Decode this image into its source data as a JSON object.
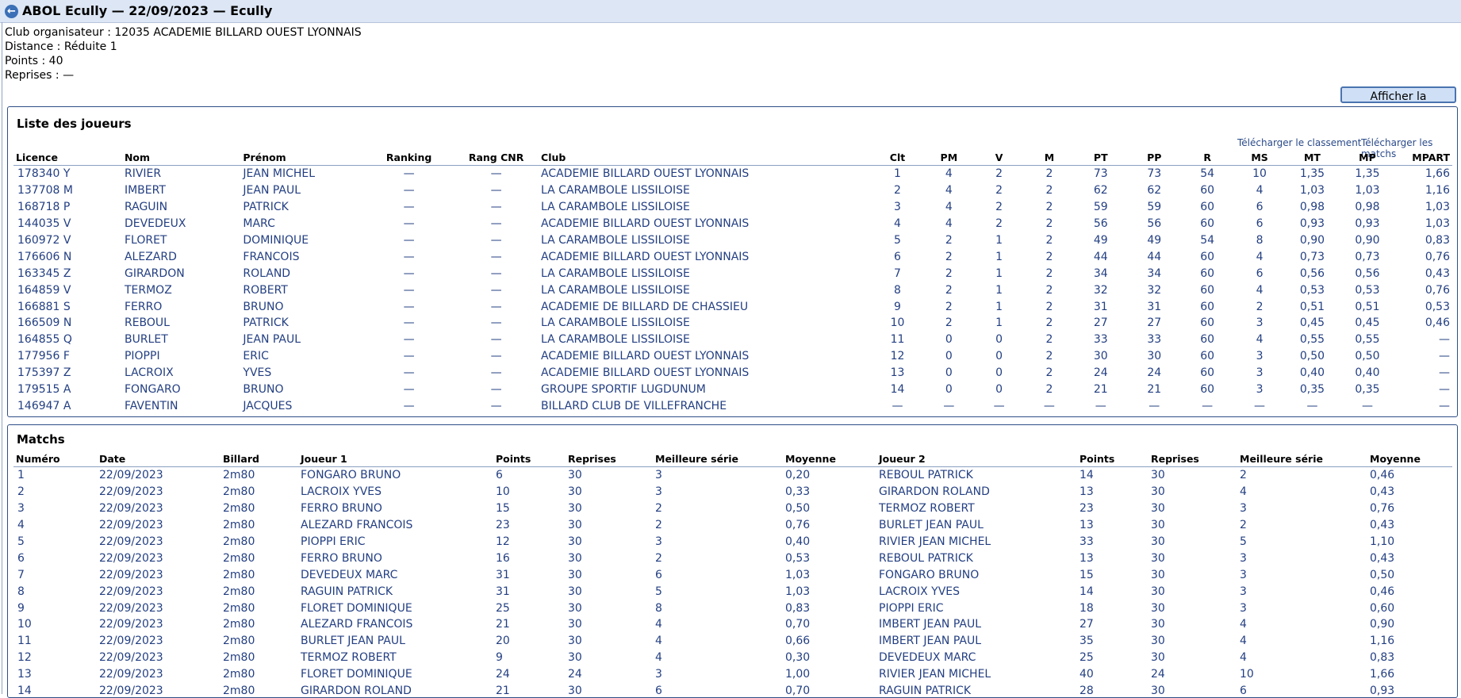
{
  "header": {
    "title": "ABOL Ecully — 22/09/2023 — Ecully",
    "back_icon": "arrow-left-icon"
  },
  "info": {
    "club_line": "Club organisateur : 12035 ACADEMIE BILLARD OUEST LYONNAIS",
    "distance_line": "Distance : Réduite 1",
    "points_line": "Points : 40",
    "reprises_line": "Reprises : —"
  },
  "actions": {
    "synthese_label": "Afficher la synthèse",
    "download_ranking_label": "Télécharger le classement",
    "download_matches_label": "Télécharger les matchs"
  },
  "players": {
    "title": "Liste des joueurs",
    "headers": [
      "Licence",
      "Nom",
      "Prénom",
      "Ranking",
      "Rang CNR",
      "Club",
      "Clt",
      "PM",
      "V",
      "M",
      "PT",
      "PP",
      "R",
      "MS",
      "MT",
      "MP",
      "MPART"
    ],
    "rows": [
      [
        "178340 Y",
        "RIVIER",
        "JEAN MICHEL",
        "—",
        "—",
        "ACADEMIE BILLARD OUEST LYONNAIS",
        "1",
        "4",
        "2",
        "2",
        "73",
        "73",
        "54",
        "10",
        "1,35",
        "1,35",
        "1,66"
      ],
      [
        "137708 M",
        "IMBERT",
        "JEAN PAUL",
        "—",
        "—",
        "LA CARAMBOLE LISSILOISE",
        "2",
        "4",
        "2",
        "2",
        "62",
        "62",
        "60",
        "4",
        "1,03",
        "1,03",
        "1,16"
      ],
      [
        "168718 P",
        "RAGUIN",
        "PATRICK",
        "—",
        "—",
        "LA CARAMBOLE LISSILOISE",
        "3",
        "4",
        "2",
        "2",
        "59",
        "59",
        "60",
        "6",
        "0,98",
        "0,98",
        "1,03"
      ],
      [
        "144035 V",
        "DEVEDEUX",
        "MARC",
        "—",
        "—",
        "ACADEMIE BILLARD OUEST LYONNAIS",
        "4",
        "4",
        "2",
        "2",
        "56",
        "56",
        "60",
        "6",
        "0,93",
        "0,93",
        "1,03"
      ],
      [
        "160972 V",
        "FLORET",
        "DOMINIQUE",
        "—",
        "—",
        "LA CARAMBOLE LISSILOISE",
        "5",
        "2",
        "1",
        "2",
        "49",
        "49",
        "54",
        "8",
        "0,90",
        "0,90",
        "0,83"
      ],
      [
        "176606 N",
        "ALEZARD",
        "FRANCOIS",
        "—",
        "—",
        "ACADEMIE BILLARD OUEST LYONNAIS",
        "6",
        "2",
        "1",
        "2",
        "44",
        "44",
        "60",
        "4",
        "0,73",
        "0,73",
        "0,76"
      ],
      [
        "163345 Z",
        "GIRARDON",
        "ROLAND",
        "—",
        "—",
        "LA CARAMBOLE LISSILOISE",
        "7",
        "2",
        "1",
        "2",
        "34",
        "34",
        "60",
        "6",
        "0,56",
        "0,56",
        "0,43"
      ],
      [
        "164859 V",
        "TERMOZ",
        "ROBERT",
        "—",
        "—",
        "LA CARAMBOLE LISSILOISE",
        "8",
        "2",
        "1",
        "2",
        "32",
        "32",
        "60",
        "4",
        "0,53",
        "0,53",
        "0,76"
      ],
      [
        "166881 S",
        "FERRO",
        "BRUNO",
        "—",
        "—",
        "ACADEMIE DE BILLARD DE CHASSIEU",
        "9",
        "2",
        "1",
        "2",
        "31",
        "31",
        "60",
        "2",
        "0,51",
        "0,51",
        "0,53"
      ],
      [
        "166509 N",
        "REBOUL",
        "PATRICK",
        "—",
        "—",
        "LA CARAMBOLE LISSILOISE",
        "10",
        "2",
        "1",
        "2",
        "27",
        "27",
        "60",
        "3",
        "0,45",
        "0,45",
        "0,46"
      ],
      [
        "164855 Q",
        "BURLET",
        "JEAN PAUL",
        "—",
        "—",
        "LA CARAMBOLE LISSILOISE",
        "11",
        "0",
        "0",
        "2",
        "33",
        "33",
        "60",
        "4",
        "0,55",
        "0,55",
        "—"
      ],
      [
        "177956 F",
        "PIOPPI",
        "ERIC",
        "—",
        "—",
        "ACADEMIE BILLARD OUEST LYONNAIS",
        "12",
        "0",
        "0",
        "2",
        "30",
        "30",
        "60",
        "3",
        "0,50",
        "0,50",
        "—"
      ],
      [
        "175397 Z",
        "LACROIX",
        "YVES",
        "—",
        "—",
        "ACADEMIE BILLARD OUEST LYONNAIS",
        "13",
        "0",
        "0",
        "2",
        "24",
        "24",
        "60",
        "3",
        "0,40",
        "0,40",
        "—"
      ],
      [
        "179515 A",
        "FONGARO",
        "BRUNO",
        "—",
        "—",
        "GROUPE SPORTIF LUGDUNUM",
        "14",
        "0",
        "0",
        "2",
        "21",
        "21",
        "60",
        "3",
        "0,35",
        "0,35",
        "—"
      ],
      [
        "146947 A",
        "FAVENTIN",
        "JACQUES",
        "—",
        "—",
        "BILLARD CLUB DE VILLEFRANCHE",
        "—",
        "—",
        "—",
        "—",
        "—",
        "—",
        "—",
        "—",
        "—",
        "—",
        "—"
      ]
    ]
  },
  "matches": {
    "title": "Matchs",
    "headers": [
      "Numéro",
      "Date",
      "Billard",
      "Joueur 1",
      "Points",
      "Reprises",
      "Meilleure série",
      "Moyenne",
      "Joueur 2",
      "Points",
      "Reprises",
      "Meilleure série",
      "Moyenne"
    ],
    "rows": [
      [
        "1",
        "22/09/2023",
        "2m80",
        "FONGARO BRUNO",
        "6",
        "30",
        "3",
        "0,20",
        "REBOUL PATRICK",
        "14",
        "30",
        "2",
        "0,46"
      ],
      [
        "2",
        "22/09/2023",
        "2m80",
        "LACROIX YVES",
        "10",
        "30",
        "3",
        "0,33",
        "GIRARDON ROLAND",
        "13",
        "30",
        "4",
        "0,43"
      ],
      [
        "3",
        "22/09/2023",
        "2m80",
        "FERRO BRUNO",
        "15",
        "30",
        "2",
        "0,50",
        "TERMOZ ROBERT",
        "23",
        "30",
        "3",
        "0,76"
      ],
      [
        "4",
        "22/09/2023",
        "2m80",
        "ALEZARD FRANCOIS",
        "23",
        "30",
        "2",
        "0,76",
        "BURLET JEAN PAUL",
        "13",
        "30",
        "2",
        "0,43"
      ],
      [
        "5",
        "22/09/2023",
        "2m80",
        "PIOPPI ERIC",
        "12",
        "30",
        "3",
        "0,40",
        "RIVIER JEAN MICHEL",
        "33",
        "30",
        "5",
        "1,10"
      ],
      [
        "6",
        "22/09/2023",
        "2m80",
        "FERRO BRUNO",
        "16",
        "30",
        "2",
        "0,53",
        "REBOUL PATRICK",
        "13",
        "30",
        "3",
        "0,43"
      ],
      [
        "7",
        "22/09/2023",
        "2m80",
        "DEVEDEUX MARC",
        "31",
        "30",
        "6",
        "1,03",
        "FONGARO BRUNO",
        "15",
        "30",
        "3",
        "0,50"
      ],
      [
        "8",
        "22/09/2023",
        "2m80",
        "RAGUIN PATRICK",
        "31",
        "30",
        "5",
        "1,03",
        "LACROIX YVES",
        "14",
        "30",
        "3",
        "0,46"
      ],
      [
        "9",
        "22/09/2023",
        "2m80",
        "FLORET DOMINIQUE",
        "25",
        "30",
        "8",
        "0,83",
        "PIOPPI ERIC",
        "18",
        "30",
        "3",
        "0,60"
      ],
      [
        "10",
        "22/09/2023",
        "2m80",
        "ALEZARD FRANCOIS",
        "21",
        "30",
        "4",
        "0,70",
        "IMBERT JEAN PAUL",
        "27",
        "30",
        "4",
        "0,90"
      ],
      [
        "11",
        "22/09/2023",
        "2m80",
        "BURLET JEAN PAUL",
        "20",
        "30",
        "4",
        "0,66",
        "IMBERT JEAN PAUL",
        "35",
        "30",
        "4",
        "1,16"
      ],
      [
        "12",
        "22/09/2023",
        "2m80",
        "TERMOZ ROBERT",
        "9",
        "30",
        "4",
        "0,30",
        "DEVEDEUX MARC",
        "25",
        "30",
        "4",
        "0,83"
      ],
      [
        "13",
        "22/09/2023",
        "2m80",
        "FLORET DOMINIQUE",
        "24",
        "24",
        "3",
        "1,00",
        "RIVIER JEAN MICHEL",
        "40",
        "24",
        "10",
        "1,66"
      ],
      [
        "14",
        "22/09/2023",
        "2m80",
        "GIRARDON ROLAND",
        "21",
        "30",
        "6",
        "0,70",
        "RAGUIN PATRICK",
        "28",
        "30",
        "6",
        "0,93"
      ]
    ]
  }
}
